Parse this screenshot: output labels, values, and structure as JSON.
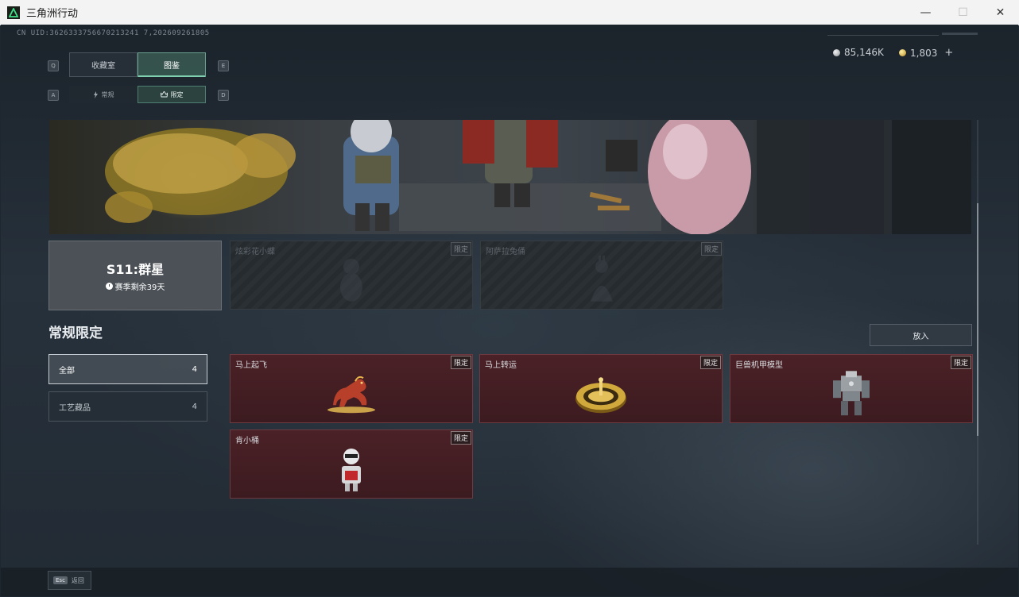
{
  "window": {
    "title": "三角洲行动",
    "minimize": "—",
    "maximize": "☐",
    "close": "✕"
  },
  "header": {
    "uid": "CN UID:3626333756670213241 7,202609261805",
    "currency_silver": "85,146K",
    "currency_gold": "1,803",
    "plus": "+"
  },
  "tabs": {
    "main": [
      {
        "label": "收藏室",
        "active": false
      },
      {
        "label": "图鉴",
        "active": true
      }
    ],
    "sub": [
      {
        "label": "常规",
        "active": false
      },
      {
        "label": "限定",
        "active": true
      }
    ],
    "keys": {
      "prev_main": "Q",
      "next_main": "E",
      "prev_sub": "A",
      "next_sub": "D"
    }
  },
  "season": {
    "title": "S11:群星",
    "remaining": "赛季剩余39天"
  },
  "season_items": [
    {
      "name": "炫彩花小蝶",
      "tag": "限定"
    },
    {
      "name": "阿萨拉兔俑",
      "tag": "限定"
    }
  ],
  "section": {
    "title": "常规限定",
    "put_in_button": "放入"
  },
  "filters": [
    {
      "label": "全部",
      "count": "4",
      "active": true
    },
    {
      "label": "工艺藏品",
      "count": "4",
      "active": false
    }
  ],
  "items": [
    {
      "name": "马上起飞",
      "tag": "限定",
      "icon": "red-horse-figure-icon"
    },
    {
      "name": "马上转运",
      "tag": "限定",
      "icon": "golden-roulette-icon"
    },
    {
      "name": "巨兽机甲模型",
      "tag": "限定",
      "icon": "mech-model-icon"
    },
    {
      "name": "肯小桶",
      "tag": "限定",
      "icon": "bucket-mascot-icon"
    }
  ],
  "footer": {
    "esc_key": "Esc",
    "esc_label": "返回"
  },
  "colors": {
    "accent": "#7fd1b0",
    "item_card_bg": "#4a2126",
    "window_bg": "#1e272f"
  }
}
